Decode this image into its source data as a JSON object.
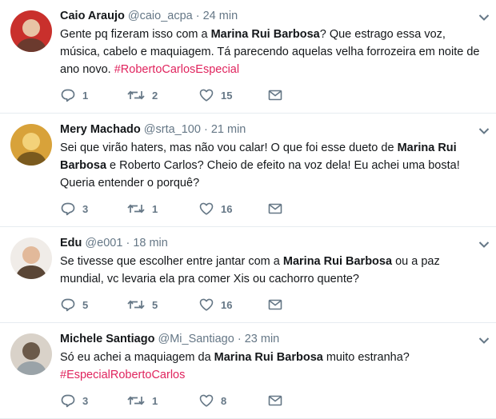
{
  "tweets": [
    {
      "name": "Caio Araujo",
      "handle": "@caio_acpa",
      "dot": "·",
      "time": "24 min",
      "text": [
        {
          "t": "Gente pq fizeram isso com a ",
          "s": "plain"
        },
        {
          "t": "Marina Rui Barbosa",
          "s": "bold"
        },
        {
          "t": "? Que estrago essa voz, música, cabelo e maquiagem. Tá parecendo aquelas velha forrozeira em noite de ano novo. ",
          "s": "plain"
        },
        {
          "t": "#RobertoCarlosEspecial",
          "s": "tag"
        }
      ],
      "replies": "1",
      "retweets": "2",
      "likes": "15",
      "avatar_colors": [
        "#6b3a2e",
        "#c9302c",
        "#e8c3a5"
      ]
    },
    {
      "name": "Mery Machado",
      "handle": "@srta_100",
      "dot": "·",
      "time": "21 min",
      "text": [
        {
          "t": "Sei que virão haters, mas não vou calar! O que foi esse dueto de ",
          "s": "plain"
        },
        {
          "t": "Marina Rui Barbosa",
          "s": "bold"
        },
        {
          "t": " e Roberto Carlos? Cheio de efeito na voz dela! Eu achei uma bosta! Queria entender o porquê?",
          "s": "plain"
        }
      ],
      "replies": "3",
      "retweets": "1",
      "likes": "16",
      "avatar_colors": [
        "#7a5a1e",
        "#d8a23a",
        "#f3d27a"
      ]
    },
    {
      "name": "Edu",
      "handle": "@e001",
      "dot": "·",
      "time": "18 min",
      "text": [
        {
          "t": "Se tivesse que escolher entre jantar com a ",
          "s": "plain"
        },
        {
          "t": "Marina Rui Barbosa",
          "s": "bold"
        },
        {
          "t": " ou a paz mundial, vc levaria ela pra comer Xis ou cachorro quente?",
          "s": "plain"
        }
      ],
      "replies": "5",
      "retweets": "5",
      "likes": "16",
      "avatar_colors": [
        "#5a4636",
        "#f0ece8",
        "#e2b99a"
      ]
    },
    {
      "name": "Michele Santiago",
      "handle": "@Mi_Santiago",
      "dot": "·",
      "time": "23 min",
      "text": [
        {
          "t": "Só eu achei a maquiagem da ",
          "s": "plain"
        },
        {
          "t": "Marina Rui Barbosa",
          "s": "bold"
        },
        {
          "t": " muito estranha? ",
          "s": "plain"
        },
        {
          "t": "#EspecialRobertoCarlos",
          "s": "tag"
        }
      ],
      "replies": "3",
      "retweets": "1",
      "likes": "8",
      "avatar_colors": [
        "#9aa3a8",
        "#d9d2c9",
        "#6b5a4a"
      ]
    }
  ],
  "colors": {
    "hashtag": "#e0245e",
    "muted": "#657786",
    "divider": "#e6ecf0"
  },
  "icons": [
    "reply-icon",
    "retweet-icon",
    "like-icon",
    "direct-message-icon",
    "chevron-down-icon"
  ]
}
